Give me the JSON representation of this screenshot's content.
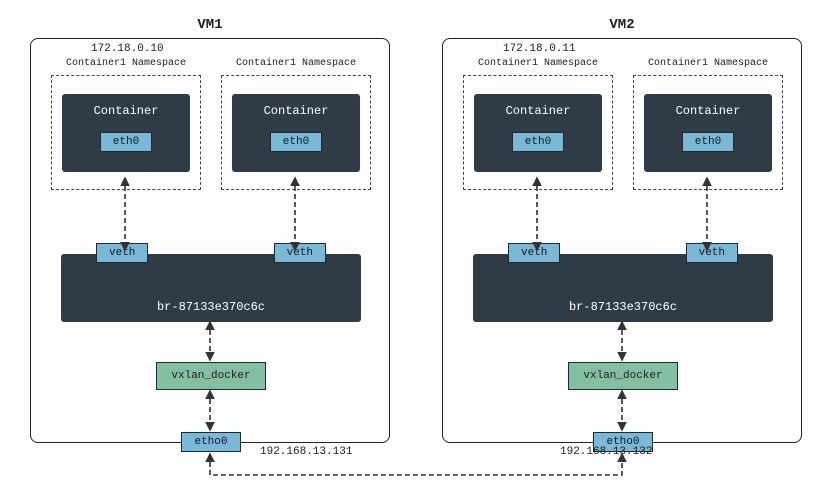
{
  "vm1": {
    "title": "VM1",
    "container_ip": "172.18.0.10",
    "host_ip": "192.168.13.131",
    "namespaces": [
      {
        "title": "Container1 Namespace",
        "box_label": "Container",
        "iface": "eth0"
      },
      {
        "title": "Container1 Namespace",
        "box_label": "Container",
        "iface": "eth0"
      }
    ],
    "bridge": {
      "name": "br-87133e370c6c",
      "veth_label": "veth"
    },
    "vxlan_label": "vxlan_docker",
    "host_iface": "etho0"
  },
  "vm2": {
    "title": "VM2",
    "container_ip": "172.18.0.11",
    "host_ip": "192.168.13.132",
    "namespaces": [
      {
        "title": "Container1 Namespace",
        "box_label": "Container",
        "iface": "eth0"
      },
      {
        "title": "Container1 Namespace",
        "box_label": "Container",
        "iface": "eth0"
      }
    ],
    "bridge": {
      "name": "br-87133e370c6c",
      "veth_label": "veth"
    },
    "vxlan_label": "vxlan_docker",
    "host_iface": "etho0"
  },
  "colors": {
    "node_bg": "#2f3b47",
    "tag_bg": "#7ab8d6",
    "vxlan_bg": "#84bfa3"
  }
}
